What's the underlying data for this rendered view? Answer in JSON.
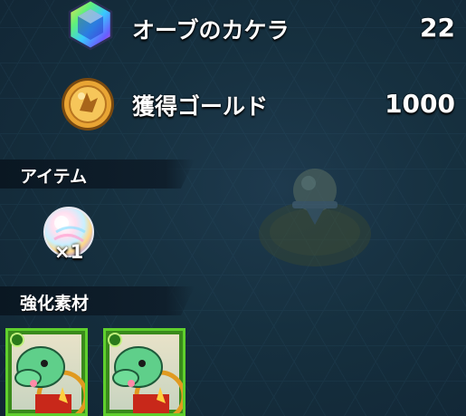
{
  "rewards": {
    "orb_fragments": {
      "label": "オーブのカケラ",
      "value": "22",
      "icon": "rainbow-gem-icon"
    },
    "gold": {
      "label": "獲得ゴールド",
      "value": "1000",
      "icon": "gold-coin-icon"
    }
  },
  "sections": {
    "items": {
      "title": "アイテム"
    },
    "materials": {
      "title": "強化素材"
    }
  },
  "items": [
    {
      "icon": "rainbow-orb-icon",
      "quantity": "×1"
    }
  ],
  "materials": [
    {
      "icon": "green-dragon-card-icon"
    },
    {
      "icon": "green-dragon-card-icon"
    }
  ],
  "colors": {
    "card_border": "#5fcf2d",
    "background": "#16303f",
    "header_bar": "#0a1722"
  }
}
